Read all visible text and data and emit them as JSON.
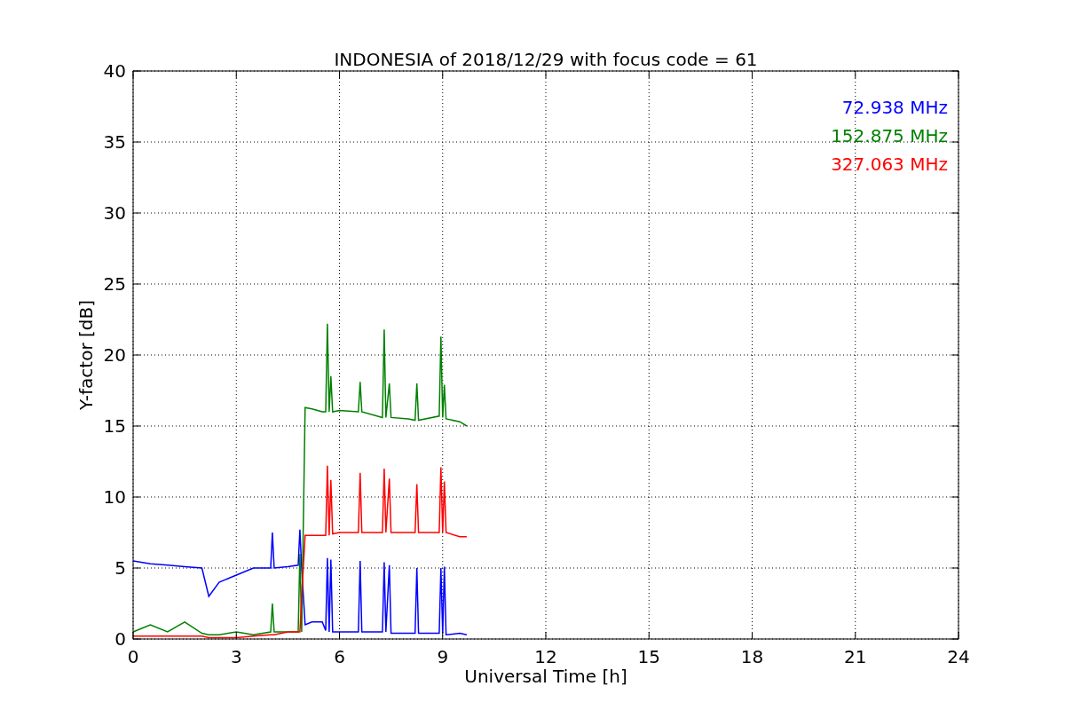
{
  "chart_data": {
    "type": "line",
    "title": "INDONESIA of 2018/12/29 with focus code = 61",
    "xlabel": "Universal Time [h]",
    "ylabel": "Y-factor [dB]",
    "x": [
      0,
      0.5,
      1,
      1.5,
      2,
      2.2,
      2.5,
      3,
      3.5,
      4,
      4.05,
      4.1,
      4.5,
      4.8,
      4.85,
      4.9,
      5,
      5.2,
      5.5,
      5.6,
      5.65,
      5.7,
      5.75,
      5.8,
      6,
      6.55,
      6.6,
      6.65,
      7.25,
      7.3,
      7.35,
      7.45,
      7.5,
      8,
      8.2,
      8.25,
      8.3,
      8.9,
      8.95,
      9,
      9.05,
      9.1,
      9.5,
      9.7
    ],
    "series": [
      {
        "name": "72.938 MHz",
        "color": "#0000ff",
        "values": [
          5.5,
          5.3,
          5.2,
          5.1,
          5.0,
          3.0,
          4.0,
          4.5,
          5.0,
          5.0,
          7.5,
          5.0,
          5.1,
          5.2,
          7.7,
          5.0,
          1.0,
          1.2,
          1.2,
          0.6,
          5.7,
          0.5,
          5.6,
          0.5,
          0.5,
          0.5,
          5.5,
          0.5,
          0.5,
          5.4,
          0.5,
          5.2,
          0.4,
          0.4,
          0.4,
          5.0,
          0.4,
          0.4,
          5.0,
          0.4,
          5.1,
          0.3,
          0.4,
          0.3
        ]
      },
      {
        "name": "152.875 MHz",
        "color": "#008000",
        "values": [
          0.5,
          1.0,
          0.5,
          1.2,
          0.4,
          0.3,
          0.3,
          0.5,
          0.3,
          0.5,
          2.5,
          0.5,
          0.5,
          0.5,
          6.0,
          0.5,
          16.3,
          16.2,
          16.0,
          16.0,
          22.2,
          16.0,
          18.5,
          16.0,
          16.1,
          16.0,
          18.1,
          16.0,
          15.6,
          21.8,
          15.6,
          18.0,
          15.6,
          15.5,
          15.4,
          18.0,
          15.4,
          15.7,
          21.3,
          15.6,
          17.9,
          15.5,
          15.3,
          15.0
        ]
      },
      {
        "name": "327.063 MHz",
        "color": "#ff0000",
        "values": [
          0.2,
          0.2,
          0.2,
          0.2,
          0.2,
          0.1,
          0.1,
          0.1,
          0.2,
          0.3,
          0.3,
          0.3,
          0.5,
          0.5,
          0.5,
          3.0,
          7.3,
          7.3,
          7.3,
          7.3,
          12.2,
          7.3,
          11.2,
          7.4,
          7.5,
          7.5,
          11.7,
          7.5,
          7.5,
          12.0,
          7.5,
          11.3,
          7.5,
          7.5,
          7.5,
          10.9,
          7.5,
          7.5,
          12.1,
          7.5,
          11.1,
          7.5,
          7.2,
          7.2
        ]
      }
    ],
    "xlim": [
      0,
      24
    ],
    "ylim": [
      0,
      40
    ],
    "xticks": [
      0,
      3,
      6,
      9,
      12,
      15,
      18,
      21,
      24
    ],
    "yticks": [
      0,
      5,
      10,
      15,
      20,
      25,
      30,
      35,
      40
    ],
    "grid": true
  }
}
